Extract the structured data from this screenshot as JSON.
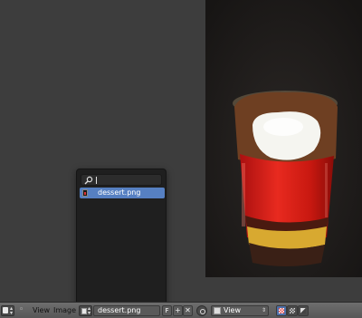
{
  "header": {
    "menu_view": "View",
    "menu_image": "Image",
    "image_name": "dessert.png",
    "fake_user_label": "F",
    "new_button_glyph": "+",
    "close_button_glyph": "✕",
    "mode_value": "View",
    "mode_arrow": "⇕"
  },
  "popup": {
    "search_value": "",
    "items": [
      {
        "label": "dessert.png"
      }
    ]
  },
  "icons": {
    "editor_type": "image-editor-icon",
    "add_region": "plus-icon",
    "image_selector": "image-browse-icon",
    "search": "search-icon",
    "pin": "pin-icon",
    "mode": "mode-icon",
    "draw_channels": "checker-icon"
  },
  "colors": {
    "highlight": "#5680c2",
    "background": "#3d3d3d",
    "header": "#626262"
  }
}
